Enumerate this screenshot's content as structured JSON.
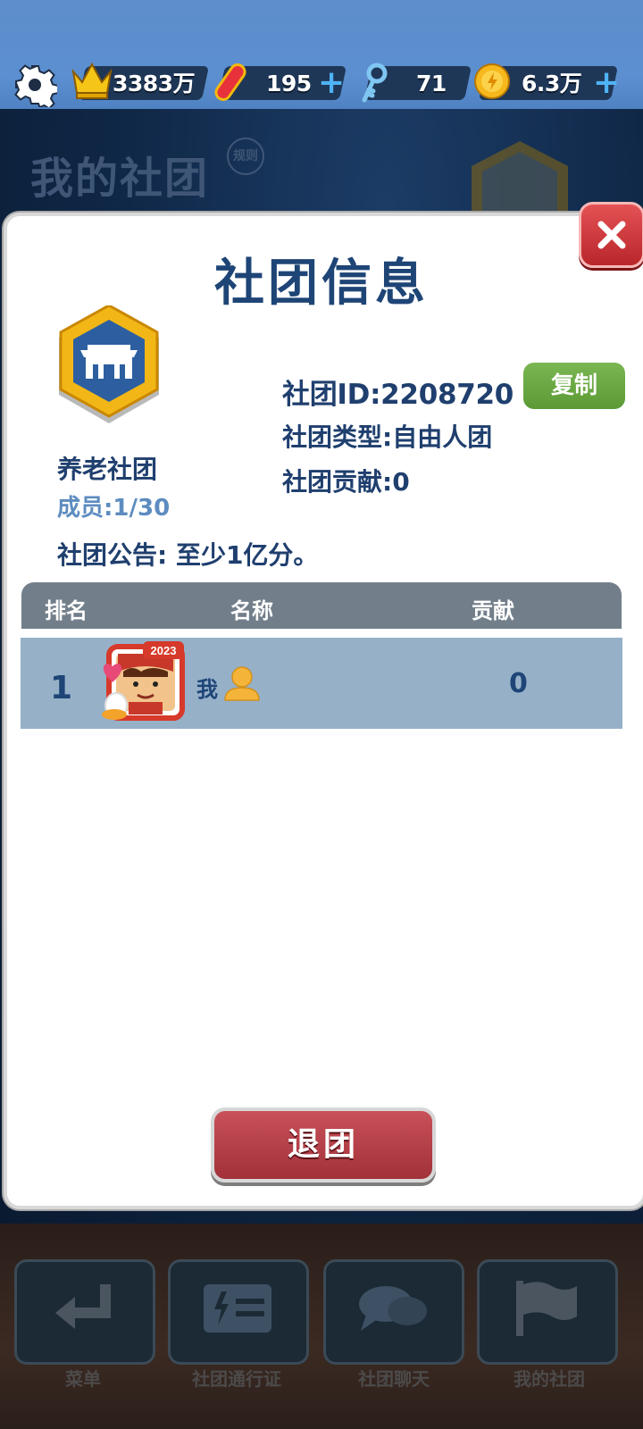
{
  "topbar": {
    "crowns": "3383万",
    "boards": "195",
    "keys": "71",
    "coins": "6.3万",
    "plus": "+"
  },
  "background": {
    "title": "我的社团",
    "rule": "规则"
  },
  "nav": {
    "items": [
      {
        "label": "菜单",
        "icon": "return-arrow-icon"
      },
      {
        "label": "社团通行证",
        "icon": "pass-icon"
      },
      {
        "label": "社团聊天",
        "icon": "chat-icon"
      },
      {
        "label": "我的社团",
        "icon": "flag-icon"
      }
    ]
  },
  "modal": {
    "title": "社团信息",
    "club_id": "社团ID:2208720",
    "copy": "复制",
    "club_type": "社团类型:自由人团",
    "contribution": "社团贡献:0",
    "club_name": "养老社团",
    "members": "成员:1/30",
    "notice": "社团公告: 至少1亿分。",
    "table": {
      "headers": [
        "排名",
        "名称",
        "贡献"
      ],
      "rows": [
        {
          "rank": "1",
          "name": "我",
          "contribution": "0",
          "avatar_badge": "2023"
        }
      ]
    },
    "quit": "退团"
  },
  "colors": {
    "accent_blue": "#1e4576",
    "copy_green": "#6aa944",
    "close_red": "#c9353a"
  }
}
